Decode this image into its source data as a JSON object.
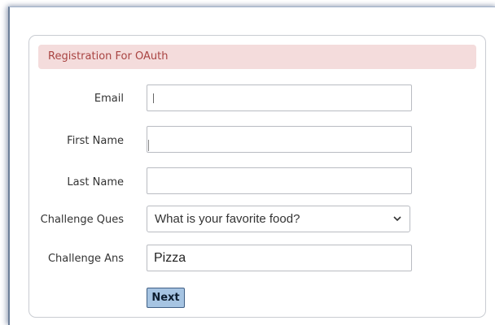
{
  "form": {
    "header": "Registration For OAuth",
    "email_label": "Email",
    "email_value": "",
    "first_name_label": "First Name",
    "first_name_value": "",
    "last_name_label": "Last Name",
    "last_name_value": "",
    "challenge_question_label": "Challenge Ques",
    "challenge_question_selected": "What is your favorite food?",
    "challenge_answer_label": "Challenge Ans",
    "challenge_answer_value": "Pizza",
    "next_label": "Next"
  },
  "icons": {
    "dropdown": "chevron-down-icon"
  },
  "colors": {
    "header_bg": "#f4dcdc",
    "header_text": "#a94442",
    "button_bg": "#a6c4e2",
    "button_border": "#3f5f85"
  }
}
